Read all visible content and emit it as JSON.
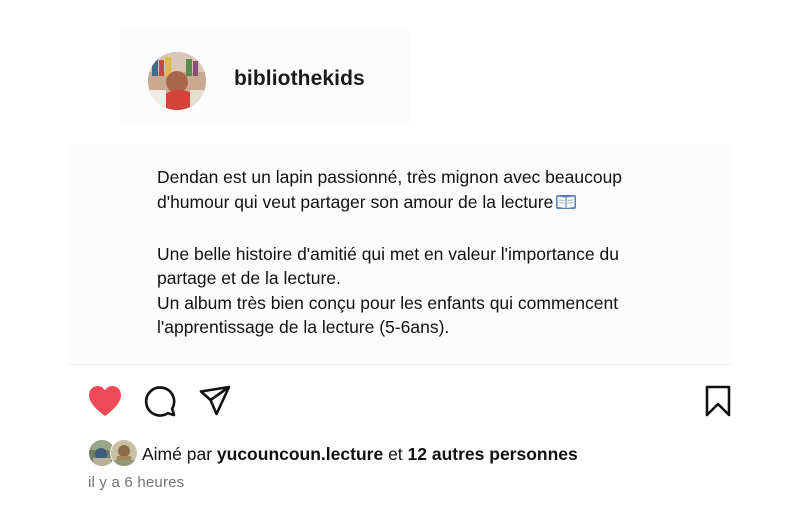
{
  "post": {
    "username": "bibliothekids",
    "caption": {
      "line1": "Dendan est un lapin passionné, très mignon avec beaucoup",
      "line2": "d'humour qui veut partager son amour de la lecture",
      "line2_emoji": "open-book-emoji",
      "line3": "Une belle histoire d'amitié qui met en valeur l'importance du",
      "line4": "partage et de la lecture.",
      "line5": "Un album très bien conçu pour les enfants qui commencent",
      "line6": "l'apprentissage de la lecture (5-6ans)."
    },
    "actions": {
      "like_icon": "heart-icon",
      "like_state": "liked",
      "like_color": "#ed4956",
      "comment_icon": "comment-icon",
      "share_icon": "share-icon",
      "save_icon": "bookmark-icon"
    },
    "likes": {
      "prefix": "Aimé par",
      "user": "yucouncoun.lecture",
      "connector": "et",
      "others": "12 autres personnes"
    },
    "timestamp": "il y a 6 heures"
  }
}
